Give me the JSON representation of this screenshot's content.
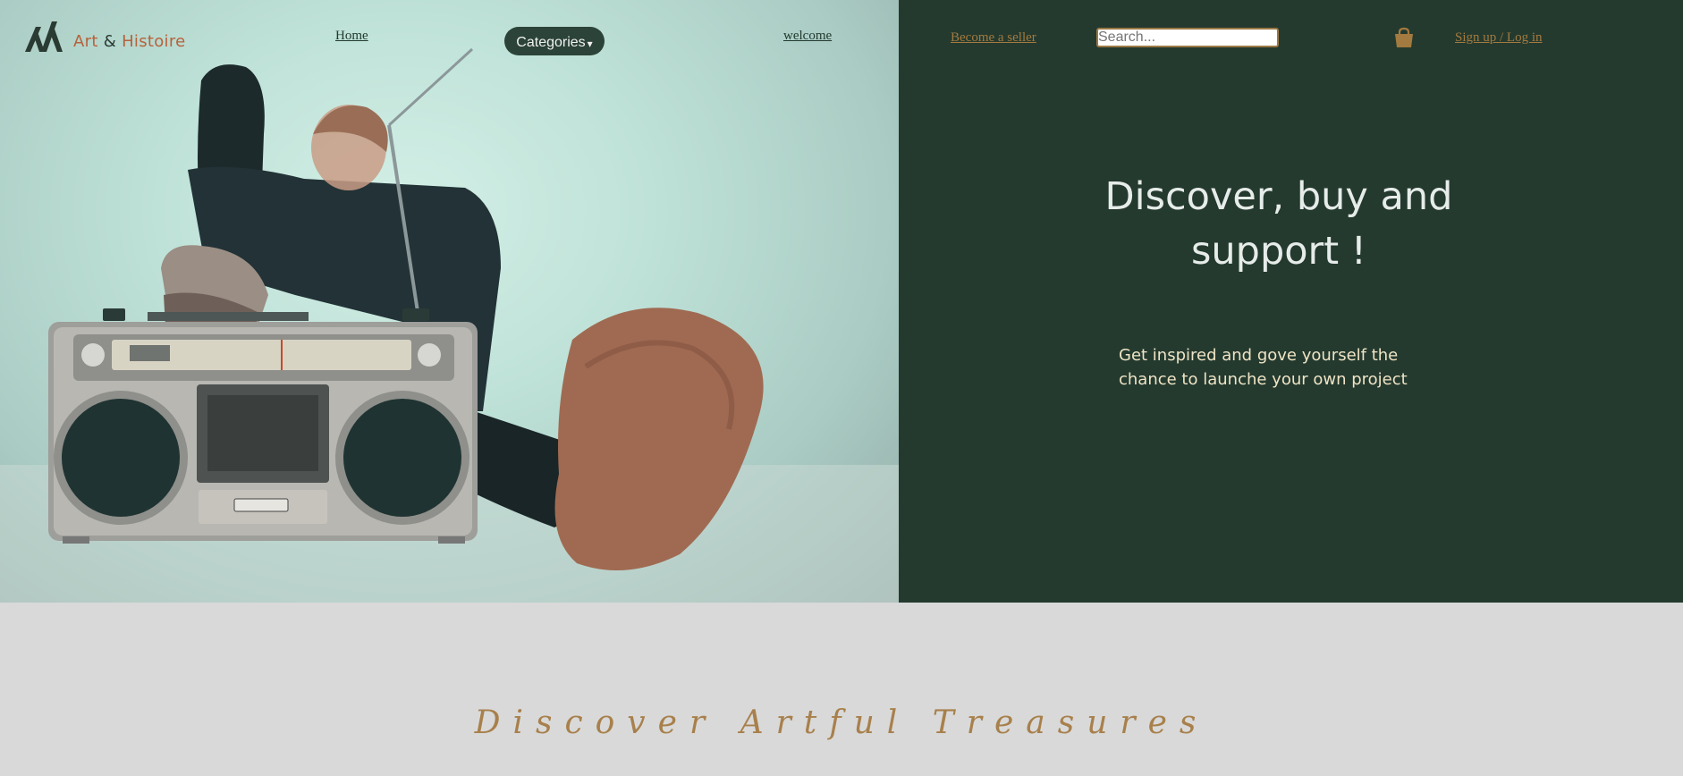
{
  "nav": {
    "logo_text_1": "Art",
    "logo_amp": "&",
    "logo_text_2": "Histoire",
    "home": "Home",
    "categories": "Categories",
    "caret": "▾",
    "welcome": "welcome",
    "become_seller": "Become a seller",
    "search_placeholder": "Search...",
    "cart_icon": "shopping-bag-icon",
    "signup": "Sign up / Log in"
  },
  "hero": {
    "title": "Discover, buy and support !",
    "subtitle": "Get inspired and gove yourself the chance to launche your own project"
  },
  "section": {
    "title": "Discover Artful Treasures"
  },
  "colors": {
    "panel": "#243a2f",
    "accent": "#a37a3f",
    "background": "#d9d9d9"
  }
}
